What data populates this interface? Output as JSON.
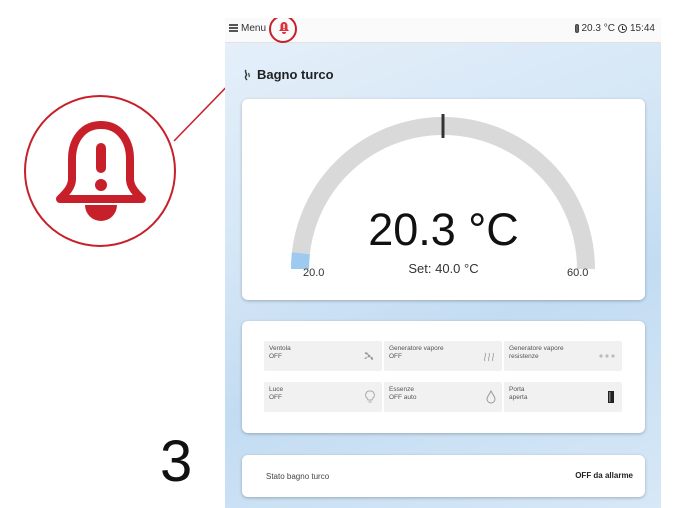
{
  "step_number": "3",
  "topbar": {
    "menu_label": "Menu",
    "temperature": "20.3 °C",
    "time": "15:44"
  },
  "page": {
    "title": "Bagno turco"
  },
  "gauge": {
    "temperature": "20.3 °C",
    "setpoint": "Set: 40.0 °C",
    "min_label": "20.0",
    "max_label": "60.0",
    "min": 20.0,
    "max": 60.0,
    "current": 20.3,
    "set": 40.0
  },
  "tiles": [
    {
      "name": "Ventola",
      "state": "OFF",
      "icon": "fan-icon"
    },
    {
      "name": "Generatore vapore",
      "state": "OFF",
      "icon": "steam-icon"
    },
    {
      "name": "Generatore vapore",
      "state": "resistenze",
      "icon": "heater-icon"
    },
    {
      "name": "Luce",
      "state": "OFF",
      "icon": "bulb-icon"
    },
    {
      "name": "Essenze",
      "state": "OFF auto",
      "icon": "drop-icon"
    },
    {
      "name": "Porta",
      "state": "aperta",
      "icon": "door-icon"
    }
  ],
  "status": {
    "label": "Stato bagno turco",
    "value": "OFF da allarme"
  },
  "colors": {
    "alarm": "#c8202a",
    "gauge_track": "#d9d9d9",
    "gauge_fill": "#9ecaf0",
    "marker": "#333333"
  }
}
